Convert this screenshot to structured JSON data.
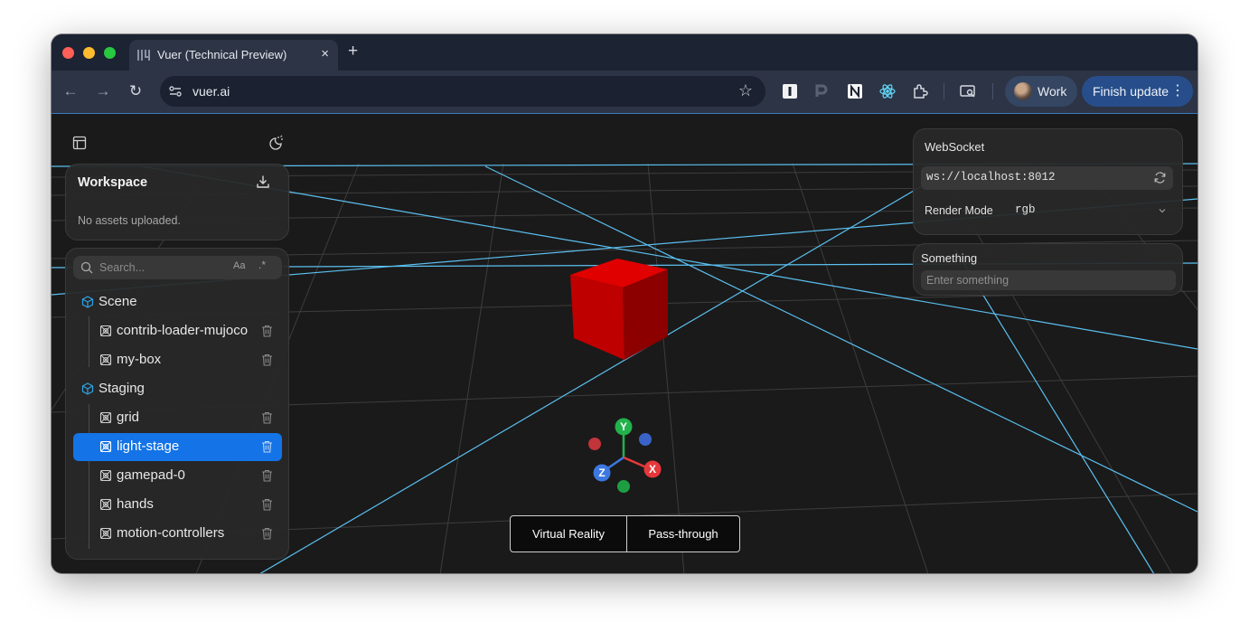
{
  "browser": {
    "tab_title": "Vuer (Technical Preview)",
    "tab_close": "×",
    "new_tab": "+",
    "url": "vuer.ai",
    "profile_label": "Work",
    "update_label": "Finish update",
    "update_menu": "⋮",
    "nav": {
      "back": "←",
      "forward": "→",
      "reload": "↻"
    },
    "star": "☆"
  },
  "sidebar": {
    "workspace_title": "Workspace",
    "assets_note": "No assets uploaded.",
    "search_placeholder": "Search...",
    "match_case_label": "Aa",
    "regex_label": ".*",
    "tree": [
      {
        "label": "Scene",
        "type": "group"
      },
      {
        "label": "contrib-loader-mujoco",
        "type": "node"
      },
      {
        "label": "my-box",
        "type": "node"
      },
      {
        "label": "Staging",
        "type": "group"
      },
      {
        "label": "grid",
        "type": "node"
      },
      {
        "label": "light-stage",
        "type": "node",
        "selected": true
      },
      {
        "label": "gamepad-0",
        "type": "node"
      },
      {
        "label": "hands",
        "type": "node"
      },
      {
        "label": "motion-controllers",
        "type": "node"
      }
    ]
  },
  "websocket_panel": {
    "title": "WebSocket",
    "url": "ws://localhost:8012",
    "render_mode_label": "Render Mode",
    "render_mode_value": "rgb"
  },
  "something_panel": {
    "title": "Something",
    "placeholder": "Enter something"
  },
  "gizmo": {
    "x": "X",
    "y": "Y",
    "z": "Z"
  },
  "mode_buttons": {
    "vr": "Virtual Reality",
    "passthrough": "Pass-through"
  },
  "colors": {
    "accent": "#1473e6",
    "grid_line": "#5bc0f0",
    "cube": "#cc0000",
    "axis_x": "#e5383b",
    "axis_y": "#22b24c",
    "axis_z": "#3c78e0"
  },
  "icons": [
    "layout-icon",
    "theme-icon",
    "download-icon",
    "search-icon",
    "cube-group-icon",
    "node-icon",
    "trash-icon",
    "refresh-icon",
    "chevron-down-icon"
  ]
}
